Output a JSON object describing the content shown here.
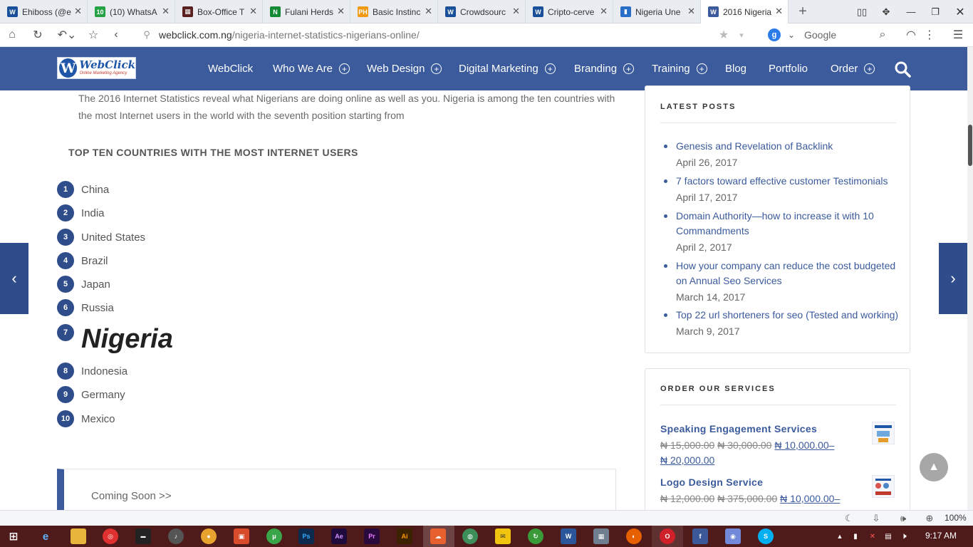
{
  "browser": {
    "tabs": [
      {
        "label": "Ehiboss (@e",
        "icon": "steemit-icon",
        "color": "#1a5099"
      },
      {
        "label": "(10) WhatsA",
        "icon": "whatsapp-icon",
        "color": "#25a244"
      },
      {
        "label": "Box-Office T",
        "icon": "film-icon",
        "color": "#5a1f1f"
      },
      {
        "label": "Fulani Herds",
        "icon": "naira-icon",
        "color": "#148a34"
      },
      {
        "label": "Basic Instinc",
        "icon": "ph-icon",
        "color": "#f19a13"
      },
      {
        "label": "Crowdsourc",
        "icon": "steemit-icon",
        "color": "#1a5099"
      },
      {
        "label": "Cripto-cerve",
        "icon": "steemit-icon",
        "color": "#1a5099"
      },
      {
        "label": "Nigeria Une",
        "icon": "chart-icon",
        "color": "#2a6fc7"
      },
      {
        "label": "2016 Nigeria",
        "icon": "wordpress-icon",
        "color": "#3b5b9c",
        "active": true
      }
    ],
    "url_domain": "webclick.com.ng",
    "url_path": "/nigeria-internet-statistics-nigerians-online/",
    "search_engine": "Google",
    "zoom": "100%"
  },
  "site": {
    "logo_main": "WebClick",
    "logo_sub": "Online Marketing Agency",
    "accent": "#3b5b9c",
    "menu": [
      {
        "label": "WebClick",
        "has_sub": false
      },
      {
        "label": "Who We Are",
        "has_sub": true
      },
      {
        "label": "Web Design",
        "has_sub": true
      },
      {
        "label": "Digital Marketing",
        "has_sub": true
      },
      {
        "label": "Branding",
        "has_sub": true
      },
      {
        "label": "Training",
        "has_sub": true
      },
      {
        "label": "Blog",
        "has_sub": false
      },
      {
        "label": "Portfolio",
        "has_sub": false
      },
      {
        "label": "Order",
        "has_sub": true
      }
    ]
  },
  "article": {
    "intro": "The 2016 Internet Statistics reveal what Nigerians are doing online as well as you. Nigeria is among the ten countries with the most Internet users in the world with the seventh position starting from",
    "heading": "TOP TEN COUNTRIES WITH THE MOST INTERNET USERS",
    "countries": [
      {
        "rank": "1",
        "name": "China"
      },
      {
        "rank": "2",
        "name": "India"
      },
      {
        "rank": "3",
        "name": "United States"
      },
      {
        "rank": "4",
        "name": "Brazil"
      },
      {
        "rank": "5",
        "name": "Japan"
      },
      {
        "rank": "6",
        "name": "Russia"
      },
      {
        "rank": "7",
        "name": "Nigeria",
        "highlight": true
      },
      {
        "rank": "8",
        "name": "Indonesia"
      },
      {
        "rank": "9",
        "name": "Germany"
      },
      {
        "rank": "10",
        "name": "Mexico"
      }
    ],
    "coming_soon": "Coming Soon >>"
  },
  "sidebar": {
    "latest_title": "LATEST POSTS",
    "posts": [
      {
        "title": "Genesis and Revelation of Backlink",
        "date": "April 26, 2017"
      },
      {
        "title": "7 factors toward effective customer Testimonials",
        "date": "April 17, 2017"
      },
      {
        "title": "Domain Authority—how to increase it with 10 Commandments",
        "date": "April 2, 2017"
      },
      {
        "title": "How your company can reduce the cost budgeted on Annual Seo Services",
        "date": "March 14, 2017"
      },
      {
        "title": "Top 22 url shorteners for seo (Tested and working)",
        "date": "March 9, 2017"
      }
    ],
    "order_title": "ORDER OUR SERVICES",
    "services": [
      {
        "title": "Speaking Engagement Services",
        "old1": "₦ 15,000.00",
        "old2": "₦ 30,000.00",
        "new1": "₦ 10,000.00",
        "new2": "₦ 20,000.00"
      },
      {
        "title": "Logo Design Service",
        "old1": "₦ 12,000.00",
        "old2": "₦ 375,000.00",
        "new1": "₦ 10,000.00",
        "new2": ""
      }
    ]
  },
  "taskbar": {
    "time": "9:17 AM"
  }
}
